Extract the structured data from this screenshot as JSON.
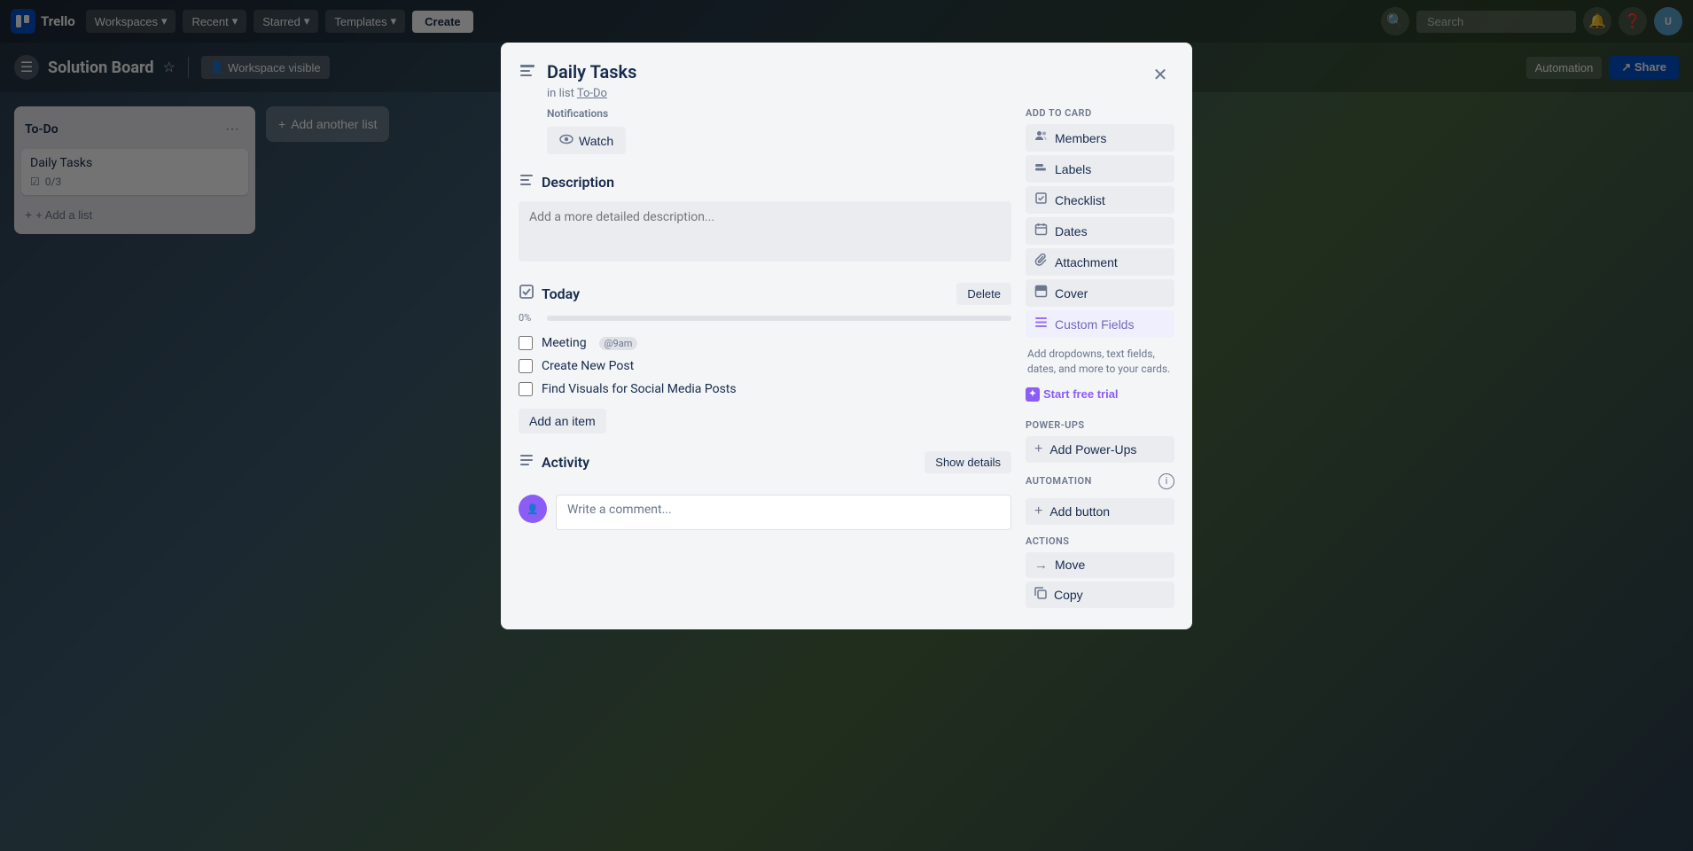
{
  "navbar": {
    "logo_text": "Trello",
    "workspaces_label": "Workspaces",
    "recent_label": "Recent",
    "starred_label": "Starred",
    "templates_label": "Templates",
    "create_label": "Create",
    "search_placeholder": "Search",
    "search_label": "Search"
  },
  "board": {
    "title": "Solution Board",
    "workspace_visible": "Workspace visible",
    "automation_label": "Automation",
    "share_label": "Share"
  },
  "columns": [
    {
      "id": "todo",
      "title": "To-Do",
      "cards": [
        {
          "id": "daily-tasks",
          "title": "Daily Tasks",
          "checklist": "0/3"
        }
      ]
    }
  ],
  "add_list_label": "+ Add a list",
  "modal": {
    "card_title": "Daily Tasks",
    "in_list_label": "in list",
    "list_name": "To-Do",
    "close_label": "×",
    "notifications": {
      "label": "Notifications",
      "watch_label": "Watch"
    },
    "description": {
      "section_label": "Description",
      "placeholder": "Add a more detailed description..."
    },
    "checklist": {
      "section_label": "Today",
      "delete_label": "Delete",
      "progress_pct": "0%",
      "progress_value": 0,
      "items": [
        {
          "id": "item1",
          "text": "Meeting",
          "tag": "@9am",
          "checked": false
        },
        {
          "id": "item2",
          "text": "Create New Post",
          "tag": "",
          "checked": false
        },
        {
          "id": "item3",
          "text": "Find Visuals for Social Media Posts",
          "tag": "",
          "checked": false
        }
      ],
      "add_item_label": "Add an item"
    },
    "activity": {
      "section_label": "Activity",
      "show_details_label": "Show details",
      "comment_placeholder": "Write a comment..."
    },
    "sidebar": {
      "add_to_card_label": "Add to card",
      "members_label": "Members",
      "labels_label": "Labels",
      "checklist_label": "Checklist",
      "dates_label": "Dates",
      "attachment_label": "Attachment",
      "cover_label": "Cover",
      "custom_fields_label": "Custom Fields",
      "custom_fields_sub": "Add dropdowns, text fields, dates, and more to your cards.",
      "start_free_trial_label": "Start free trial",
      "power_ups_label": "Power-Ups",
      "add_power_ups_label": "Add Power-Ups",
      "automation_label": "Automation",
      "add_button_label": "Add button",
      "actions_label": "Actions",
      "move_label": "Move",
      "copy_label": "Copy"
    }
  }
}
